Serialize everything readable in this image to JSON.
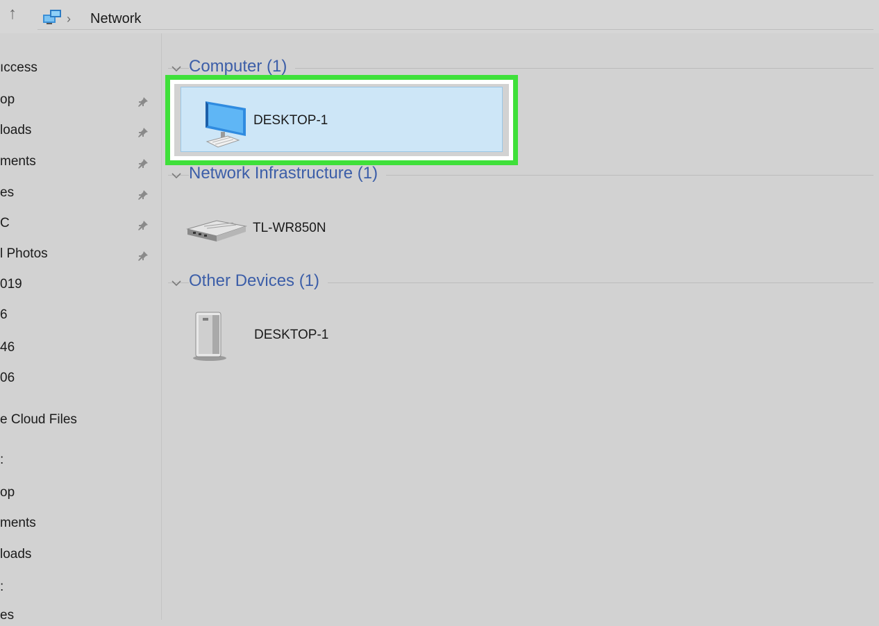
{
  "addressbar": {
    "breadcrumb": "Network",
    "separator": "›",
    "up_icon": "up-arrow-icon",
    "location_icon": "network-icon"
  },
  "navpane": {
    "items": [
      {
        "label": "ıccess",
        "pinned": false
      },
      {
        "label": "op",
        "pinned": true
      },
      {
        "label": "loads",
        "pinned": true
      },
      {
        "label": "ments",
        "pinned": true
      },
      {
        "label": "es",
        "pinned": true
      },
      {
        "label": "C",
        "pinned": true
      },
      {
        "label": "l Photos",
        "pinned": true
      },
      {
        "label": "019",
        "pinned": false
      },
      {
        "label": "6",
        "pinned": false
      },
      {
        "label": "46",
        "pinned": false
      },
      {
        "label": "06",
        "pinned": false
      },
      {
        "label": "e Cloud Files",
        "pinned": false
      },
      {
        "label": ":",
        "pinned": false
      },
      {
        "label": "op",
        "pinned": false
      },
      {
        "label": "ments",
        "pinned": false
      },
      {
        "label": "loads",
        "pinned": false
      },
      {
        "label": ":",
        "pinned": false
      },
      {
        "label": "es",
        "pinned": false
      }
    ]
  },
  "groups": {
    "computer": {
      "title": "Computer (1)",
      "items": [
        {
          "label": "DESKTOP-1",
          "icon": "computer-monitor-icon"
        }
      ]
    },
    "infrastructure": {
      "title": "Network Infrastructure (1)",
      "items": [
        {
          "label": "TL-WR850N",
          "icon": "router-icon"
        }
      ]
    },
    "other": {
      "title": "Other Devices (1)",
      "items": [
        {
          "label": "DESKTOP-1",
          "icon": "media-server-icon"
        }
      ]
    }
  },
  "colors": {
    "highlight": "#3fe03a",
    "selection": "#cde6f7",
    "group_header": "#3c5ea8"
  }
}
